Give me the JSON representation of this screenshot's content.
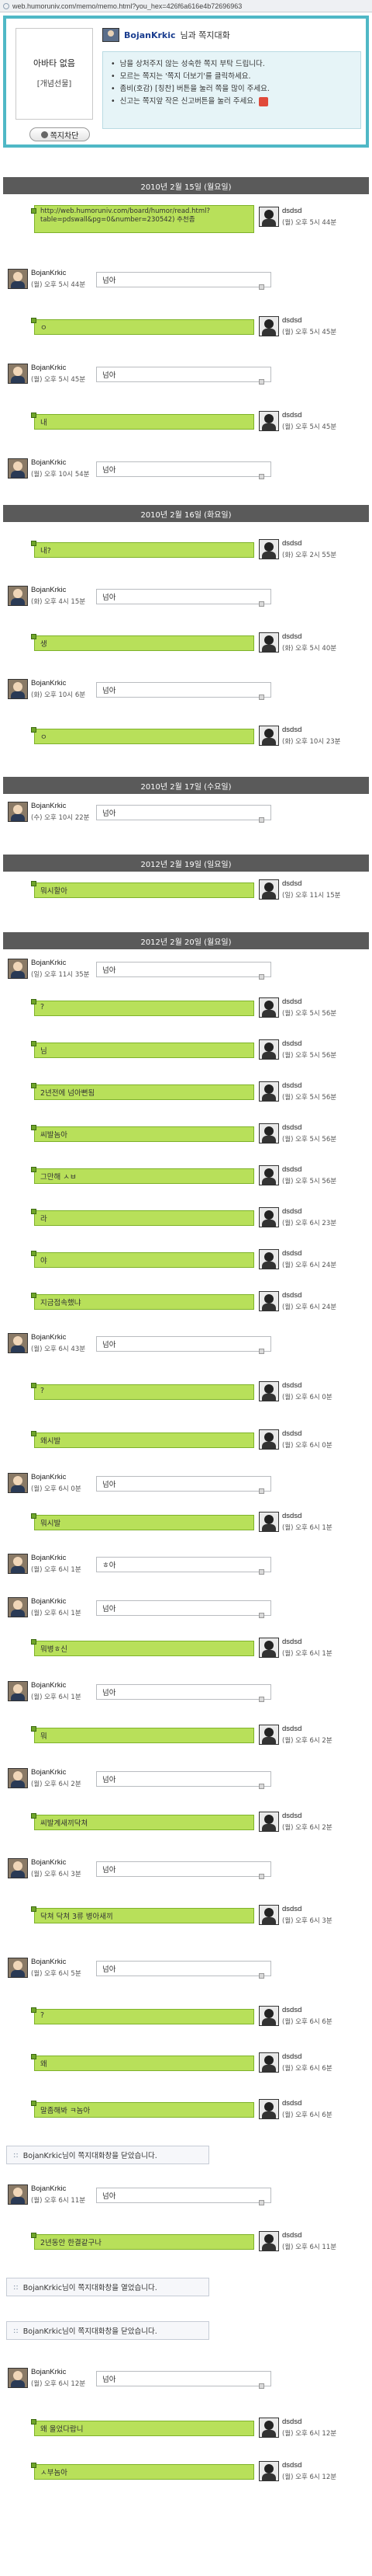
{
  "browser": {
    "url": "web.humoruniv.com/memo/memo.html?you_hex=426f6a616e4b72696963"
  },
  "profile": {
    "avatar_line1": "아바타 없음",
    "avatar_line2": "[개념선물]",
    "block_label": "쪽지차단",
    "username": "BojanKrkic",
    "title_suffix": "님과 쪽지대화",
    "notice": [
      "남을 상처주지 않는 성숙한 쪽지 부탁 드립니다.",
      "모르는 쪽지는 '쪽지 더보기'를 클릭하세요.",
      "좀비(호감) [칭찬] 버튼을 눌러 쪽을 많이 주세요.",
      "신고는 쪽지앞 작은 신고버튼을 눌러 주세요."
    ]
  },
  "dates": [
    "2010년 2월 15일 (월요일)",
    "2010년 2월 16일 (화요일)",
    "2010년 2월 17일 (수요일)",
    "2012년 2월 19일 (일요일)",
    "2012년 2월 20일 (월요일)"
  ],
  "messages": [
    {
      "type": "sent",
      "text": "http://web.humoruniv.com/board/humor/read.html?table=pdswall&pg=0&number=230542) 추천좀",
      "name": "dsdsd",
      "time": "(월) 오후 5시 44분"
    },
    {
      "type": "recv",
      "text": "넘아",
      "name": "BojanKrkic",
      "time": "(월) 오후 5시 44분"
    },
    {
      "type": "sent",
      "text": "ㅇ",
      "name": "dsdsd",
      "time": "(월) 오후 5시 45분"
    },
    {
      "type": "recv",
      "text": "넘아",
      "name": "BojanKrkic",
      "time": "(월) 오후 5시 45분"
    },
    {
      "type": "sent",
      "text": "내",
      "name": "dsdsd",
      "time": "(월) 오후 5시 45분"
    },
    {
      "type": "recv",
      "text": "넘아",
      "name": "BojanKrkic",
      "time": "(월) 오후 10시 54분"
    },
    {
      "type": "sent",
      "text": "내?",
      "name": "dsdsd",
      "time": "(화) 오후 2시 55분"
    },
    {
      "type": "recv",
      "text": "넘아",
      "name": "BojanKrkic",
      "time": "(화) 오후 4시 15분"
    },
    {
      "type": "sent",
      "text": "생",
      "name": "dsdsd",
      "time": "(화) 오후 5시 40분"
    },
    {
      "type": "recv",
      "text": "넘아",
      "name": "BojanKrkic",
      "time": "(화) 오후 10시 6분"
    },
    {
      "type": "sent",
      "text": "ㅇ",
      "name": "dsdsd",
      "time": "(화) 오후 10시 23분"
    },
    {
      "type": "recv",
      "text": "넘아",
      "name": "BojanKrkic",
      "time": "(수) 오후 10시 22분"
    },
    {
      "type": "sent",
      "text": "뭐시할아",
      "name": "dsdsd",
      "time": "(일) 오후 11시 15분"
    },
    {
      "type": "recv",
      "text": "넘아",
      "name": "BojanKrkic",
      "time": "(일) 오후 11시 35분"
    },
    {
      "type": "sent",
      "text": "?",
      "name": "dsdsd",
      "time": "(월) 오후 5시 56분"
    },
    {
      "type": "sent",
      "text": "님",
      "name": "dsdsd",
      "time": "(월) 오후 5시 56분"
    },
    {
      "type": "sent",
      "text": "2년전에 넘아뻔됨",
      "name": "dsdsd",
      "time": "(월) 오후 5시 56분"
    },
    {
      "type": "sent",
      "text": "씨발놈아",
      "name": "dsdsd",
      "time": "(월) 오후 5시 56분"
    },
    {
      "type": "sent",
      "text": "그만해 ㅅㅂ",
      "name": "dsdsd",
      "time": "(월) 오후 5시 56분"
    },
    {
      "type": "sent",
      "text": "라",
      "name": "dsdsd",
      "time": "(월) 오후 6시 23분"
    },
    {
      "type": "sent",
      "text": "야",
      "name": "dsdsd",
      "time": "(월) 오후 6시 24분"
    },
    {
      "type": "sent",
      "text": "지금접속했냐",
      "name": "dsdsd",
      "time": "(월) 오후 6시 24분"
    },
    {
      "type": "recv",
      "text": "넘아",
      "name": "BojanKrkic",
      "time": "(월) 오후 6시 43분"
    },
    {
      "type": "sent",
      "text": "?",
      "name": "dsdsd",
      "time": "(월) 오후 6시 0분"
    },
    {
      "type": "sent",
      "text": "왜시발",
      "name": "dsdsd",
      "time": "(월) 오후 6시 0분"
    },
    {
      "type": "recv",
      "text": "넘아",
      "name": "BojanKrkic",
      "time": "(월) 오후 6시 0분"
    },
    {
      "type": "sent",
      "text": "뭐시발",
      "name": "dsdsd",
      "time": "(월) 오후 6시 1분"
    },
    {
      "type": "recv",
      "text": "ㅎ아",
      "name": "BojanKrkic",
      "time": "(월) 오후 6시 1분"
    },
    {
      "type": "recv",
      "text": "넘아",
      "name": "BojanKrkic",
      "time": "(월) 오후 6시 1분"
    },
    {
      "type": "sent",
      "text": "뭐병ㅎ신",
      "name": "dsdsd",
      "time": "(월) 오후 6시 1분"
    },
    {
      "type": "recv",
      "text": "넘아",
      "name": "BojanKrkic",
      "time": "(월) 오후 6시 1분"
    },
    {
      "type": "sent",
      "text": "뭐",
      "name": "dsdsd",
      "time": "(월) 오후 6시 2분"
    },
    {
      "type": "recv",
      "text": "넘아",
      "name": "BojanKrkic",
      "time": "(월) 오후 6시 2분"
    },
    {
      "type": "sent",
      "text": "씨발계새끼닥쳐",
      "name": "dsdsd",
      "time": "(월) 오후 6시 2분"
    },
    {
      "type": "recv",
      "text": "넘아",
      "name": "BojanKrkic",
      "time": "(월) 오후 6시 3분"
    },
    {
      "type": "sent",
      "text": "닥쳐 닥쳐 3류 병아새끼",
      "name": "dsdsd",
      "time": "(월) 오후 6시 3분"
    },
    {
      "type": "recv",
      "text": "넘아",
      "name": "BojanKrkic",
      "time": "(월) 오후 6시 5분"
    },
    {
      "type": "sent",
      "text": "?",
      "name": "dsdsd",
      "time": "(월) 오후 6시 6분"
    },
    {
      "type": "sent",
      "text": "왜",
      "name": "dsdsd",
      "time": "(월) 오후 6시 6분"
    },
    {
      "type": "sent",
      "text": "말좀해봐 ㅋ놈아",
      "name": "dsdsd",
      "time": "(월) 오후 6시 6분"
    },
    {
      "type": "sys",
      "text": "BojanKrkic님이 쪽지대화창을 닫았습니다."
    },
    {
      "type": "recv",
      "text": "넘아",
      "name": "BojanKrkic",
      "time": "(월) 오후 6시 11분"
    },
    {
      "type": "sent",
      "text": "2년동안 한결같구나",
      "name": "dsdsd",
      "time": "(월) 오후 6시 11분"
    },
    {
      "type": "sys",
      "text": "BojanKrkic님이 쪽지대화창을 열었습니다."
    },
    {
      "type": "sys",
      "text": "BojanKrkic님이 쪽지대화창을 닫았습니다."
    },
    {
      "type": "recv",
      "text": "넘아",
      "name": "BojanKrkic",
      "time": "(월) 오후 6시 12분"
    },
    {
      "type": "sent",
      "text": "왜 울었다랍니",
      "name": "dsdsd",
      "time": "(월) 오후 6시 12분"
    },
    {
      "type": "sent",
      "text": "ㅅ부놈아",
      "name": "dsdsd",
      "time": "(월) 오후 6시 12분"
    }
  ]
}
